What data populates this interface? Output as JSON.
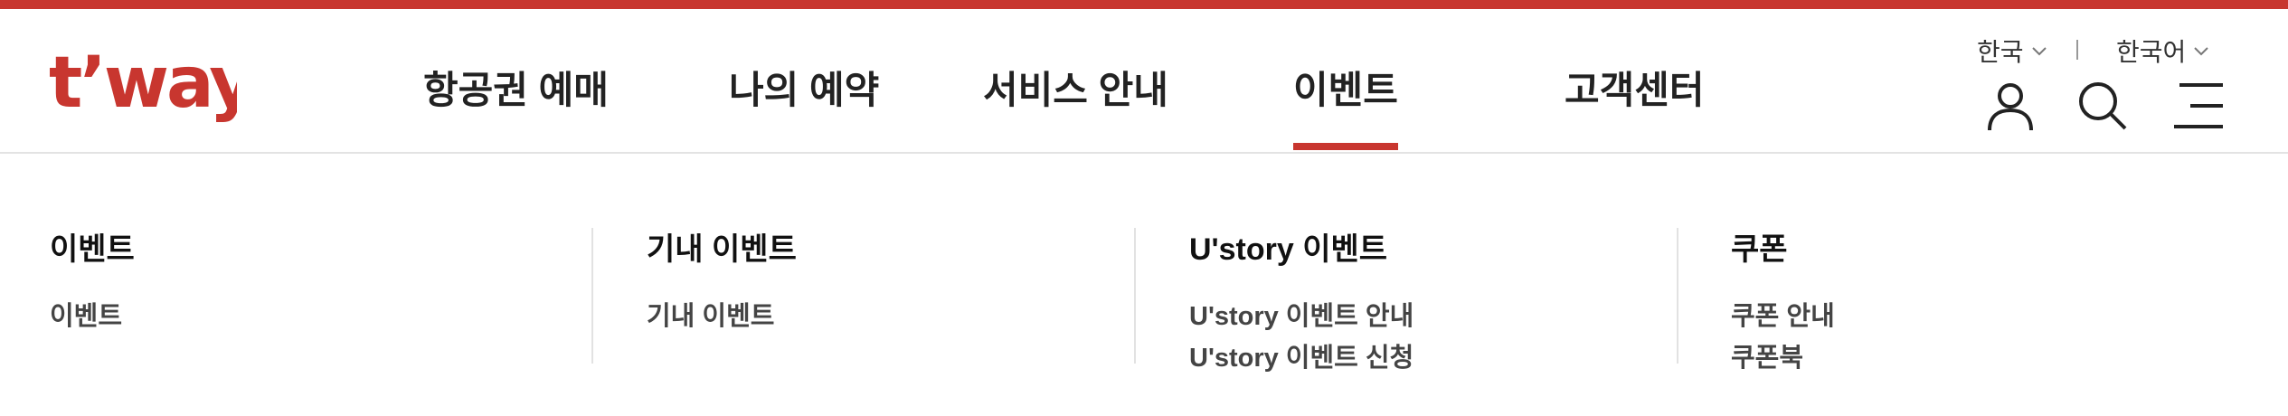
{
  "brand": {
    "logo_text": "t’way",
    "color": "#c8362f"
  },
  "nav": {
    "items": [
      {
        "label": "항공권 예매"
      },
      {
        "label": "나의 예약"
      },
      {
        "label": "서비스 안내"
      },
      {
        "label": "이벤트",
        "active": true
      },
      {
        "label": "고객센터"
      }
    ]
  },
  "util": {
    "country_label": "한국",
    "language_label": "한국어",
    "separator": "|",
    "icons": [
      "user-icon",
      "search-icon",
      "menu-icon"
    ]
  },
  "submenu": {
    "columns": [
      {
        "title": "이벤트",
        "links": [
          "이벤트"
        ]
      },
      {
        "title": "기내 이벤트",
        "links": [
          "기내 이벤트"
        ]
      },
      {
        "title": "U'story 이벤트",
        "links": [
          "U'story 이벤트 안내",
          "U'story 이벤트 신청"
        ]
      },
      {
        "title": "쿠폰",
        "links": [
          "쿠폰 안내",
          "쿠폰북"
        ]
      }
    ]
  },
  "colors": {
    "accent": "#c8362f",
    "text": "#222222",
    "border": "#e3e3e3"
  }
}
